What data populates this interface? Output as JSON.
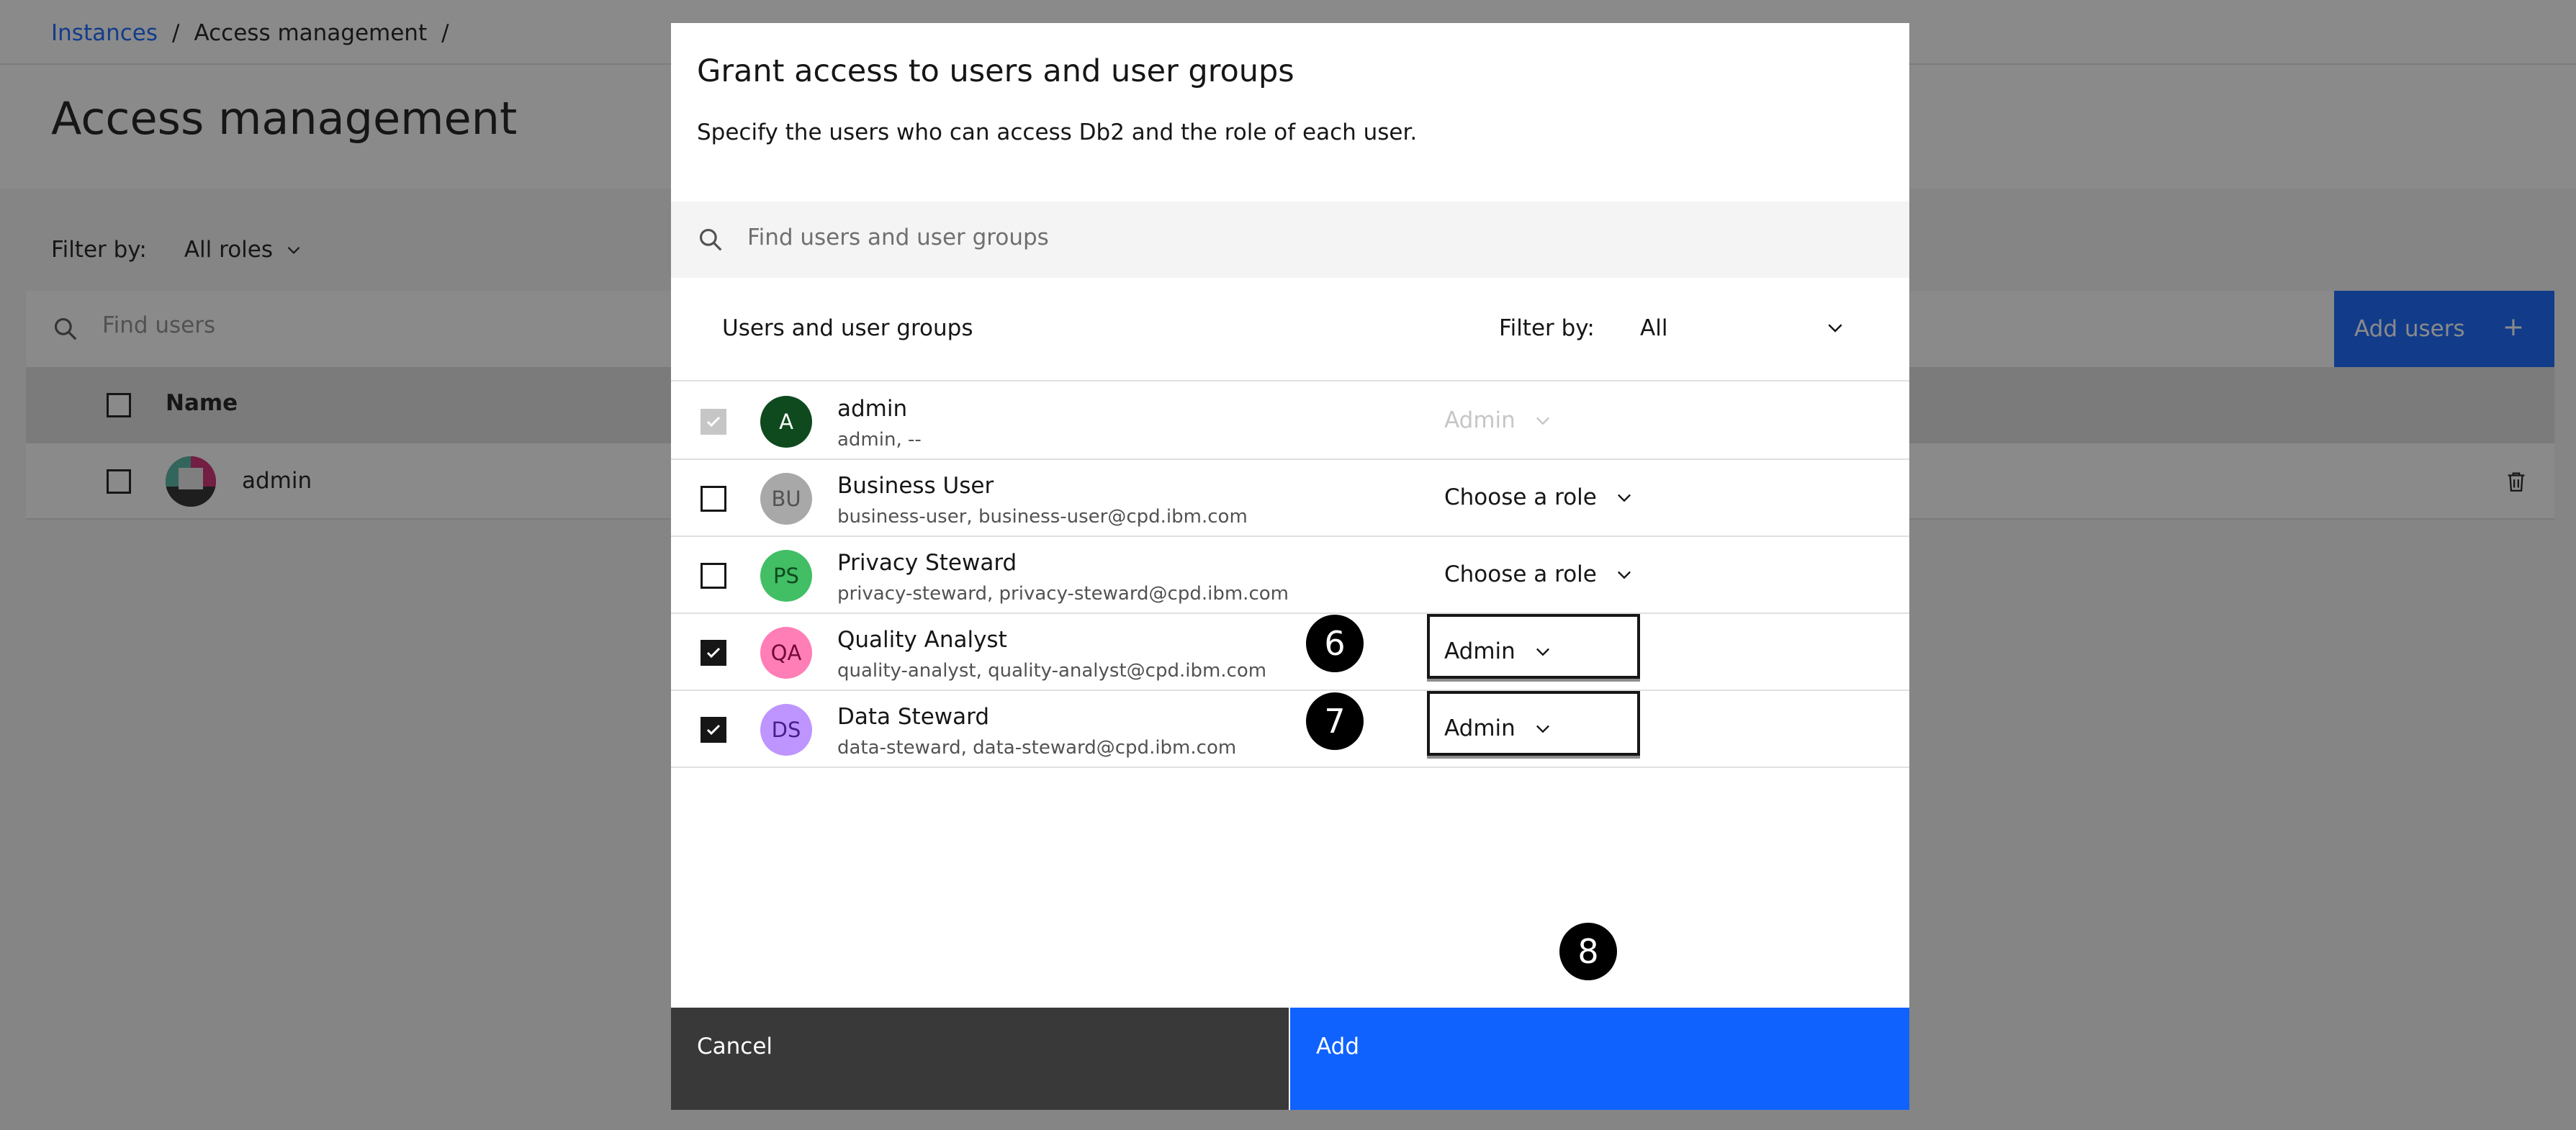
{
  "background": {
    "breadcrumb": [
      "Instances",
      "Access management"
    ],
    "breadcrumb_sep": "/",
    "page_title": "Access management",
    "filter_label": "Filter by:",
    "filter_value": "All roles",
    "search_placeholder": "Find users",
    "add_users_label": "Add users",
    "add_users_icon": "+",
    "table_header_name": "Name",
    "table_rows": [
      {
        "name": "admin"
      }
    ]
  },
  "modal": {
    "title": "Grant access to users and user groups",
    "description": "Specify the users who can access Db2 and the role of each user.",
    "search_placeholder": "Find users and user groups",
    "list_title": "Users and user groups",
    "filter_label": "Filter by:",
    "filter_value": "All",
    "users": [
      {
        "initials": "A",
        "name": "admin",
        "meta": "admin, --",
        "role": "Admin",
        "checked": true,
        "disabled": true,
        "avatar_bg": "#0e4a1e",
        "avatar_fg": "#ffffff"
      },
      {
        "initials": "BU",
        "name": "Business User",
        "meta": "business-user, business-user@cpd.ibm.com",
        "role": "Choose a role",
        "checked": false,
        "disabled": false,
        "avatar_bg": "#a8a8a8",
        "avatar_fg": "#525252"
      },
      {
        "initials": "PS",
        "name": "Privacy Steward",
        "meta": "privacy-steward, privacy-steward@cpd.ibm.com",
        "role": "Choose a role",
        "checked": false,
        "disabled": false,
        "avatar_bg": "#42be65",
        "avatar_fg": "#0e4a1e"
      },
      {
        "initials": "QA",
        "name": "Quality Analyst",
        "meta": "quality-analyst, quality-analyst@cpd.ibm.com",
        "role": "Admin",
        "checked": true,
        "disabled": false,
        "avatar_bg": "#ff7eb6",
        "avatar_fg": "#740937"
      },
      {
        "initials": "DS",
        "name": "Data Steward",
        "meta": "data-steward, data-steward@cpd.ibm.com",
        "role": "Admin",
        "checked": true,
        "disabled": false,
        "avatar_bg": "#be95ff",
        "avatar_fg": "#491d8b"
      }
    ],
    "cancel_label": "Cancel",
    "add_label": "Add"
  },
  "callouts": [
    "6",
    "7",
    "8"
  ],
  "colors": {
    "primary": "#0f62fe",
    "cancel": "#393939",
    "overlay": "rgba(22,22,22,0.5)"
  }
}
